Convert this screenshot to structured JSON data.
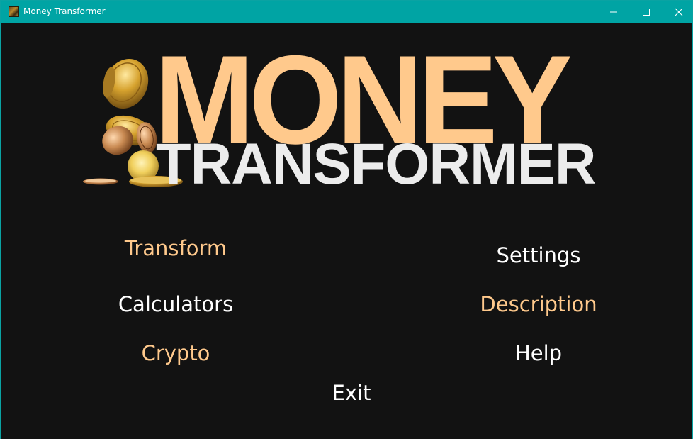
{
  "window": {
    "title": "Money Transformer",
    "icon": "money-app-icon"
  },
  "logo": {
    "line1": "MONEY",
    "line2": "TRANSFORMER",
    "image": "gold-coins-image"
  },
  "menu": {
    "transform": "Transform",
    "calculators": "Calculators",
    "crypto": "Crypto",
    "settings": "Settings",
    "description": "Description",
    "help": "Help",
    "exit": "Exit"
  },
  "colors": {
    "titlebar": "#00a4a4",
    "background": "#121212",
    "accent": "#ffc98c",
    "text": "#ffffff",
    "logo_secondary": "#ececec"
  }
}
